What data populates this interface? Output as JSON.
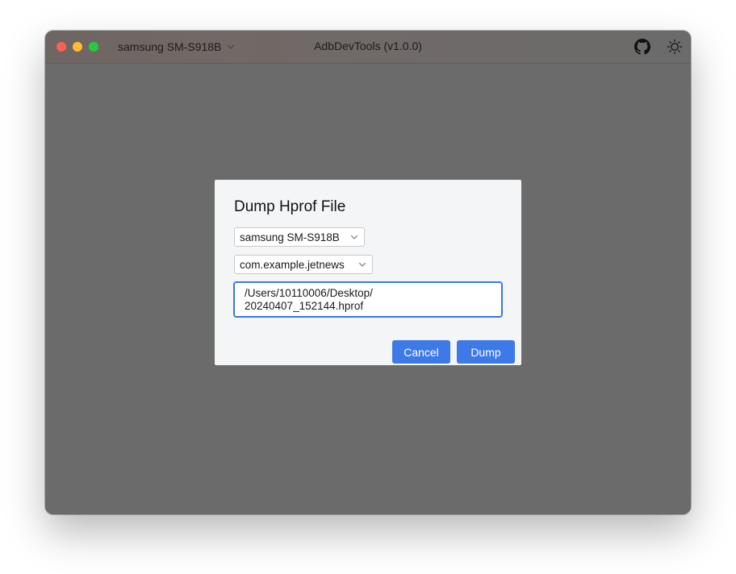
{
  "window": {
    "app_title": "AdbDevTools (v1.0.0)",
    "device_selector": "samsung SM-S918B",
    "icons": [
      "github-icon",
      "theme-toggle-icon",
      "chevron-down-icon"
    ]
  },
  "dialog": {
    "title": "Dump Hprof File",
    "device_select": "samsung SM-S918B",
    "package_select": "com.example.jetnews",
    "path_value": "/Users/10110006/Desktop/\n20240407_152144.hprof",
    "cancel_label": "Cancel",
    "dump_label": "Dump"
  },
  "colors": {
    "accent": "#3d7ae8",
    "backdrop": "#6b6b6b",
    "dialog_bg": "#f4f5f7"
  }
}
